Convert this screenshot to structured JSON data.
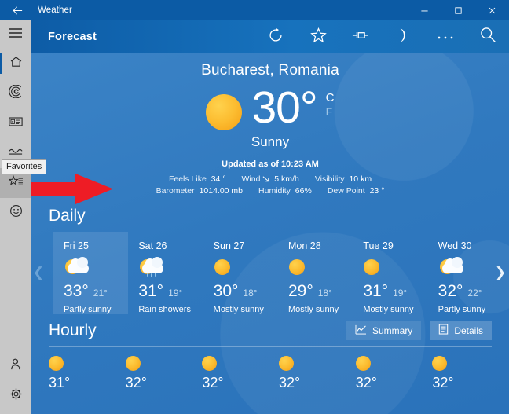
{
  "window": {
    "title": "Weather",
    "back_icon": "back-arrow-icon",
    "minimize_label": "Minimize",
    "maximize_label": "Maximize",
    "close_label": "Close"
  },
  "rail": {
    "menu_label": "Menu",
    "items": [
      {
        "name": "home",
        "icon": "home-icon",
        "label": "Home"
      },
      {
        "name": "maps",
        "icon": "radar-icon",
        "label": "Maps"
      },
      {
        "name": "news",
        "icon": "news-icon",
        "label": "News"
      },
      {
        "name": "historical",
        "icon": "historical-weather-icon",
        "label": "Historical Weather"
      },
      {
        "name": "favorites",
        "icon": "favorites-star-icon",
        "label": "Favorites"
      },
      {
        "name": "send-feedback",
        "icon": "smiley-icon",
        "label": "Send Feedback"
      }
    ],
    "bottom_items": [
      {
        "name": "add-account",
        "icon": "add-person-icon",
        "label": "Account"
      },
      {
        "name": "settings",
        "icon": "gear-icon",
        "label": "Settings"
      }
    ],
    "tooltip": "Favorites"
  },
  "header": {
    "title": "Forecast",
    "buttons": [
      {
        "name": "refresh",
        "icon": "refresh-icon",
        "label": "Refresh"
      },
      {
        "name": "favorite",
        "icon": "star-icon",
        "label": "Add to Favorites"
      },
      {
        "name": "pin",
        "icon": "pin-icon",
        "label": "Pin to Start"
      },
      {
        "name": "night-mode",
        "icon": "moon-icon",
        "label": "Night Mode"
      },
      {
        "name": "more",
        "icon": "ellipsis-icon",
        "label": "See more"
      },
      {
        "name": "search",
        "icon": "search-icon",
        "label": "Search"
      }
    ]
  },
  "current": {
    "location": "Bucharest, Romania",
    "temperature": "30",
    "degree": "°",
    "unit_celsius": "C",
    "unit_fahrenheit": "F",
    "condition": "Sunny",
    "updated": "Updated as of 10:23 AM",
    "icon": "sun-icon",
    "details_row1": [
      {
        "key": "Feels Like",
        "value": "34 °"
      },
      {
        "key": "Wind",
        "value": "5 km/h",
        "icon": "wind-direction-icon"
      },
      {
        "key": "Visibility",
        "value": "10 km"
      }
    ],
    "details_row2": [
      {
        "key": "Barometer",
        "value": "1014.00 mb"
      },
      {
        "key": "Humidity",
        "value": "66%"
      },
      {
        "key": "Dew Point",
        "value": "23 °"
      }
    ]
  },
  "daily": {
    "title": "Daily",
    "prev_label": "Previous",
    "next_label": "Next",
    "days": [
      {
        "day": "Fri 25",
        "icon": "partly-sunny-icon",
        "high": "33°",
        "low": "21°",
        "desc": "Partly sunny",
        "selected": true
      },
      {
        "day": "Sat 26",
        "icon": "rain-showers-icon",
        "high": "31°",
        "low": "19°",
        "desc": "Rain showers",
        "selected": false
      },
      {
        "day": "Sun 27",
        "icon": "sun-icon",
        "high": "30°",
        "low": "18°",
        "desc": "Mostly sunny",
        "selected": false
      },
      {
        "day": "Mon 28",
        "icon": "sun-icon",
        "high": "29°",
        "low": "18°",
        "desc": "Mostly sunny",
        "selected": false
      },
      {
        "day": "Tue 29",
        "icon": "sun-icon",
        "high": "31°",
        "low": "19°",
        "desc": "Mostly sunny",
        "selected": false
      },
      {
        "day": "Wed 30",
        "icon": "partly-sunny-icon",
        "high": "32°",
        "low": "22°",
        "desc": "Partly sunny",
        "selected": false
      }
    ]
  },
  "hourly": {
    "title": "Hourly",
    "summary_label": "Summary",
    "summary_icon": "chart-icon",
    "details_label": "Details",
    "details_icon": "list-icon",
    "hours": [
      {
        "icon": "sun-icon",
        "temp": "31°"
      },
      {
        "icon": "sun-icon",
        "temp": "32°"
      },
      {
        "icon": "sun-icon",
        "temp": "32°"
      },
      {
        "icon": "sun-icon",
        "temp": "32°"
      },
      {
        "icon": "sun-icon",
        "temp": "32°"
      },
      {
        "icon": "sun-icon",
        "temp": "32°"
      }
    ]
  },
  "colors": {
    "titlebar": "#0c5ba5",
    "rail": "#c8c8c8",
    "accent": "#1a6fb5",
    "sun": "#fcbd31",
    "annotation": "#ee1c25"
  }
}
